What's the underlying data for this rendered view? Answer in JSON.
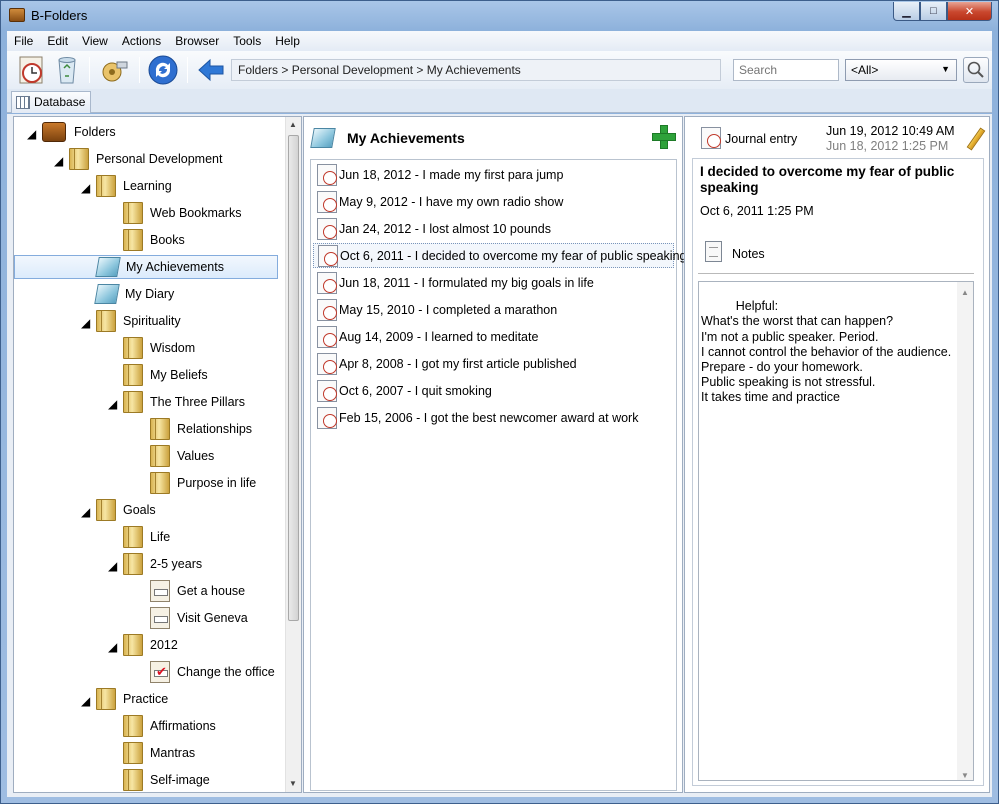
{
  "window": {
    "title": "B-Folders"
  },
  "menu": [
    "File",
    "Edit",
    "View",
    "Actions",
    "Browser",
    "Tools",
    "Help"
  ],
  "toolbar": {
    "breadcrumb": "Folders > Personal Development > My Achievements",
    "search_placeholder": "Search",
    "filter_selected": "<All>"
  },
  "tabs": {
    "database": "Database"
  },
  "tree": [
    {
      "label": "Folders",
      "icon": "briefcase-icon",
      "level": 0,
      "expanded": true
    },
    {
      "label": "Personal Development",
      "icon": "folder-icon",
      "level": 1,
      "expanded": true
    },
    {
      "label": "Learning",
      "icon": "folder-icon",
      "level": 2,
      "expanded": true
    },
    {
      "label": "Web Bookmarks",
      "icon": "folder-icon",
      "level": 3
    },
    {
      "label": "Books",
      "icon": "folder-icon",
      "level": 3
    },
    {
      "label": "My Achievements",
      "icon": "notebook-icon",
      "level": 2,
      "selected": true
    },
    {
      "label": "My Diary",
      "icon": "notebook-icon",
      "level": 2
    },
    {
      "label": "Spirituality",
      "icon": "folder-icon",
      "level": 2,
      "expanded": true
    },
    {
      "label": "Wisdom",
      "icon": "folder-icon",
      "level": 3
    },
    {
      "label": "My Beliefs",
      "icon": "folder-icon",
      "level": 3
    },
    {
      "label": "The Three Pillars",
      "icon": "folder-icon",
      "level": 3,
      "expanded": true
    },
    {
      "label": "Relationships",
      "icon": "folder-icon",
      "level": 4
    },
    {
      "label": "Values",
      "icon": "folder-icon",
      "level": 4
    },
    {
      "label": "Purpose in life",
      "icon": "folder-icon",
      "level": 4
    },
    {
      "label": "Goals",
      "icon": "folder-icon",
      "level": 2,
      "expanded": true
    },
    {
      "label": "Life",
      "icon": "folder-icon",
      "level": 3
    },
    {
      "label": "2-5 years",
      "icon": "folder-icon",
      "level": 3,
      "expanded": true
    },
    {
      "label": "Get a house",
      "icon": "task-icon",
      "level": 4
    },
    {
      "label": "Visit Geneva",
      "icon": "task-icon",
      "level": 4
    },
    {
      "label": "2012",
      "icon": "folder-icon",
      "level": 3,
      "expanded": true
    },
    {
      "label": "Change the office",
      "icon": "task-done-icon",
      "level": 4
    },
    {
      "label": "Practice",
      "icon": "folder-icon",
      "level": 2,
      "expanded": true
    },
    {
      "label": "Affirmations",
      "icon": "folder-icon",
      "level": 3
    },
    {
      "label": "Mantras",
      "icon": "folder-icon",
      "level": 3
    },
    {
      "label": "Self-image",
      "icon": "folder-icon",
      "level": 3
    }
  ],
  "list": {
    "title": "My Achievements",
    "items": [
      {
        "text": "Jun 18, 2012 - I made my first para jump"
      },
      {
        "text": "May 9, 2012 - I have my own radio show"
      },
      {
        "text": "Jan 24, 2012 - I lost almost 10 pounds"
      },
      {
        "text": "Oct 6, 2011 - I decided to overcome my fear of public speaking",
        "selected": true
      },
      {
        "text": "Jun 18, 2011 - I formulated my big goals in life"
      },
      {
        "text": "May 15, 2010 - I completed a marathon"
      },
      {
        "text": "Aug 14, 2009 - I learned to meditate"
      },
      {
        "text": "Apr 8, 2008 - I got my first article published"
      },
      {
        "text": "Oct 6, 2007 - I quit smoking"
      },
      {
        "text": "Feb 15, 2006 - I got the best newcomer award at work"
      }
    ]
  },
  "detail": {
    "type": "Journal entry",
    "created": "Jun 19, 2012 10:49 AM",
    "modified": "Jun 18, 2012 1:25 PM",
    "title": "I decided to overcome my fear of public speaking",
    "date": "Oct 6, 2011 1:25 PM",
    "notes_label": "Notes",
    "notes": "Helpful:\nWhat's the worst that can happen?\nI'm not a public speaker. Period.\nI cannot control the behavior of the audience.\nPrepare - do your homework.\nPublic speaking is not stressful.\nIt takes time and practice"
  }
}
